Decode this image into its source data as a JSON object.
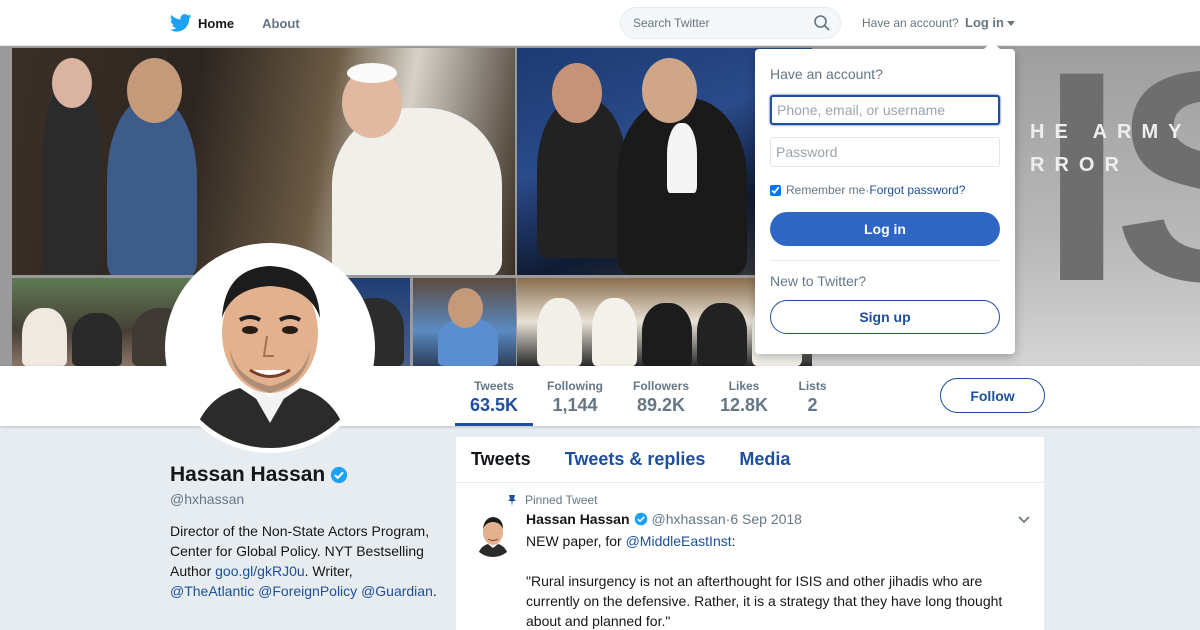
{
  "nav": {
    "home_label": "Home",
    "about_label": "About",
    "search_placeholder": "Search Twitter",
    "have_account": "Have an account?",
    "login_label": "Log in"
  },
  "banner": {
    "overlay_text_line1": "HE ARMY",
    "overlay_text_line2": "RROR",
    "big_text": "IS"
  },
  "profile": {
    "name": "Hassan Hassan",
    "handle": "@hxhassan",
    "bio_parts": {
      "p1": "Director of the Non-State Actors Program, Center for Global Policy. NYT Bestselling Author ",
      "link1": "goo.gl/gkRJ0u",
      "p2": ". Writer, ",
      "link2": "@TheAtlantic",
      "sp1": " ",
      "link3": "@ForeignPolicy",
      "sp2": " ",
      "link4": "@Guardian",
      "p3": "."
    }
  },
  "stats": [
    {
      "label": "Tweets",
      "value": "63.5K"
    },
    {
      "label": "Following",
      "value": "1,144"
    },
    {
      "label": "Followers",
      "value": "89.2K"
    },
    {
      "label": "Likes",
      "value": "12.8K"
    },
    {
      "label": "Lists",
      "value": "2"
    }
  ],
  "follow_label": "Follow",
  "timeline": {
    "tabs": [
      "Tweets",
      "Tweets & replies",
      "Media"
    ],
    "pinned_label": "Pinned Tweet",
    "tweet": {
      "name": "Hassan Hassan",
      "handle": "@hxhassan",
      "sep": " · ",
      "date": "6 Sep 2018",
      "line1_pre": "NEW paper, for ",
      "line1_link": "@MiddleEastInst",
      "line1_post": ":",
      "quote": "\"Rural insurgency is not an afterthought for ISIS and other jihadis who are currently on the defensive. Rather, it is a strategy that they have long thought about and planned for.\""
    }
  },
  "login_dropdown": {
    "title": "Have an account?",
    "username_placeholder": "Phone, email, or username",
    "password_placeholder": "Password",
    "remember_label": "Remember me",
    "dot": " · ",
    "forgot_label": "Forgot password?",
    "login_button": "Log in",
    "new_label": "New to Twitter?",
    "signup_button": "Sign up"
  },
  "colors": {
    "accent": "#1d4f9e",
    "login_button": "#2f66c3",
    "verified": "#1da1f2"
  }
}
